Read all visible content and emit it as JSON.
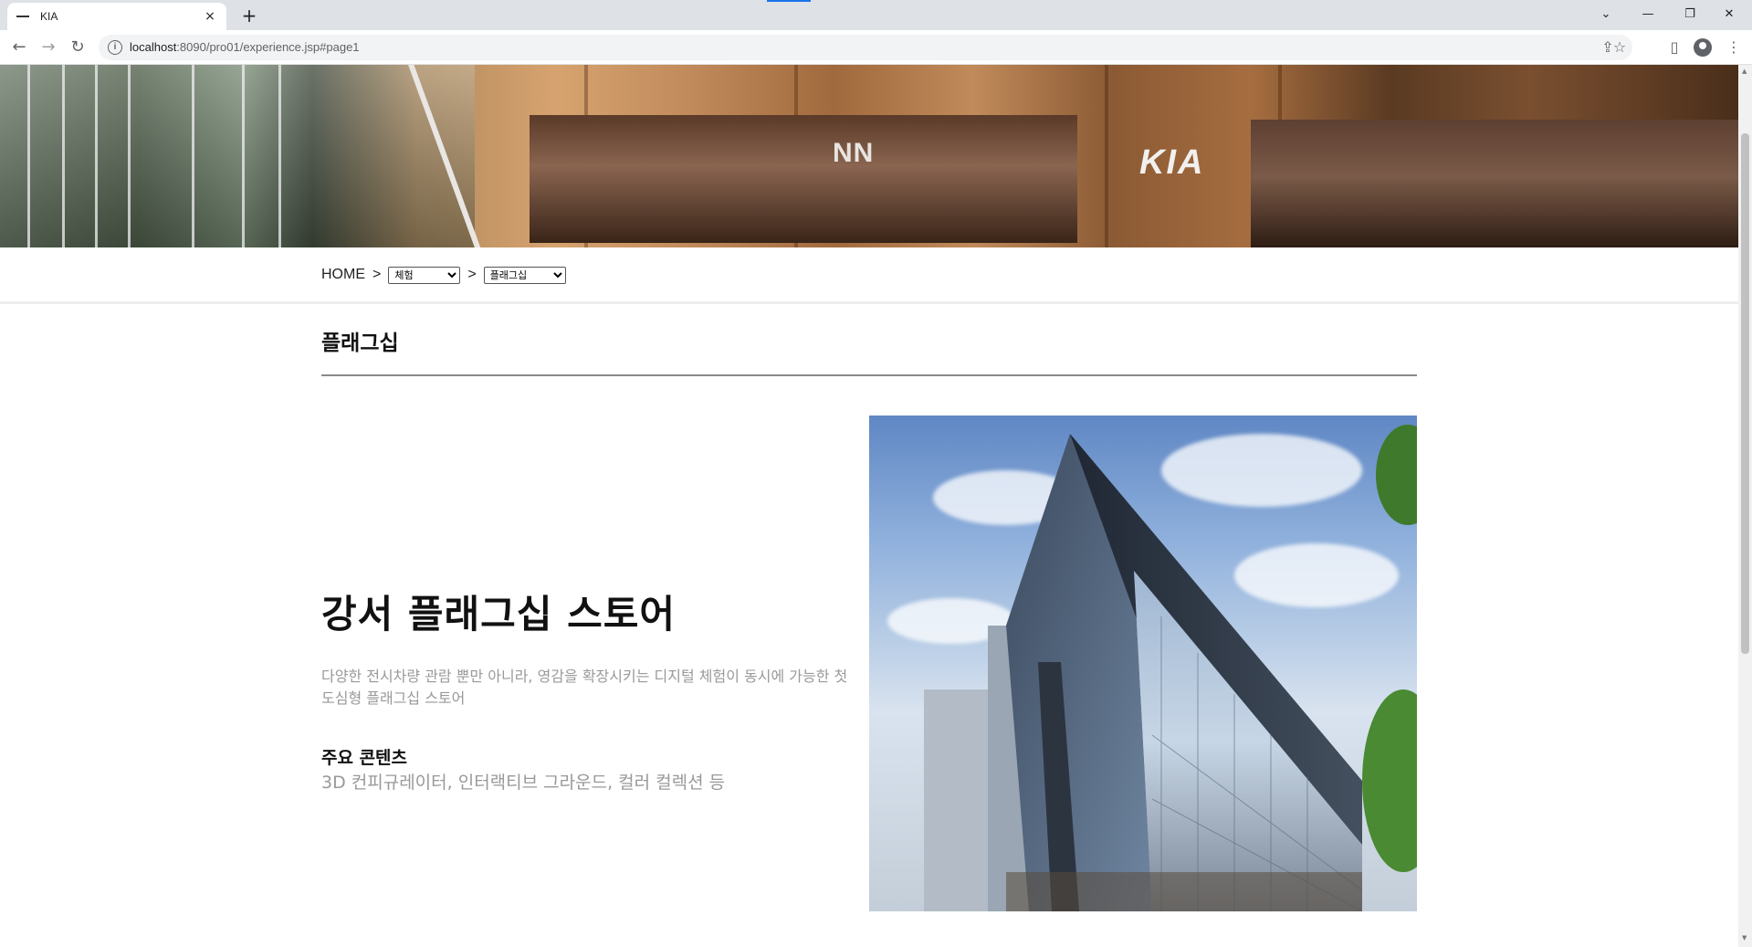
{
  "browser": {
    "tab_title": "KIA",
    "tab_close": "×",
    "new_tab": "+",
    "url_host": "localhost",
    "url_path": ":8090/pro01/experience.jsp#page1",
    "back": "←",
    "forward": "→",
    "reload": "↻",
    "info": "i",
    "share": "⇪",
    "star": "☆",
    "sidepanel": "▯",
    "menu": "⋮",
    "tab_search": "⌄",
    "minimize": "—",
    "restore": "❐",
    "close": "✕"
  },
  "hero": {
    "logo_left": "NN",
    "logo_right": "KIA"
  },
  "breadcrumb": {
    "home": "HOME",
    "separator": ">",
    "select_category": {
      "selected": "체험",
      "options": [
        "체험"
      ]
    },
    "select_page": {
      "selected": "플래그십",
      "options": [
        "플래그십"
      ]
    }
  },
  "section": {
    "title": "플래그십"
  },
  "content": {
    "store_name": "강서 플래그십 스토어",
    "description": "다양한 전시차량 관람 뿐만 아니라, 영감을 확장시키는 디지털 체험이 동시에 가능한 첫 도심형 플래그십 스토어",
    "main_heading": "주요 콘텐츠",
    "main_body": "3D 컨피규레이터, 인터랙티브 그라운드, 컬러 컬렉션 등"
  },
  "colors": {
    "accent_loading": "#1a73e8",
    "text_dark": "#111111",
    "text_muted": "#999999"
  }
}
